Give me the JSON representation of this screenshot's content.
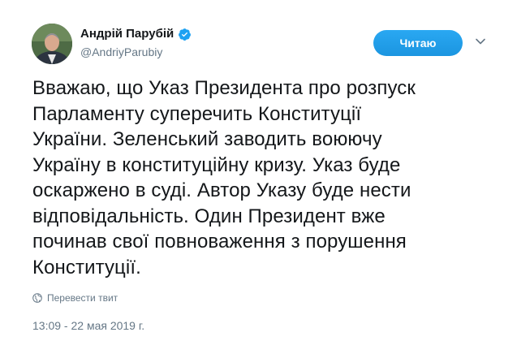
{
  "user": {
    "display_name": "Андрій Парубій",
    "handle": "@AndriyParubiy",
    "verified": true
  },
  "follow_button": {
    "label": "Читаю"
  },
  "tweet": {
    "lines": [
      "Вважаю, що Указ Президента про розпуск",
      "Парламенту суперечить Конституції",
      "України. Зеленський заводить воюючу",
      "Україну в конституційну кризу. Указ буде",
      "оскаржено в суді. Автор Указу буде нести",
      "відповідальність. Один Президент вже",
      "починав свої повноваження з порушення",
      "Конституції."
    ]
  },
  "translate": {
    "label": "Перевести твит"
  },
  "timestamp": "13:09 - 22 мая 2019 г.",
  "colors": {
    "accent": "#1da1f2",
    "muted": "#657786",
    "text": "#14171a"
  },
  "icons": {
    "verified": "verified-badge-icon",
    "caret": "chevron-down-icon",
    "globe": "globe-icon",
    "avatar": "avatar"
  }
}
